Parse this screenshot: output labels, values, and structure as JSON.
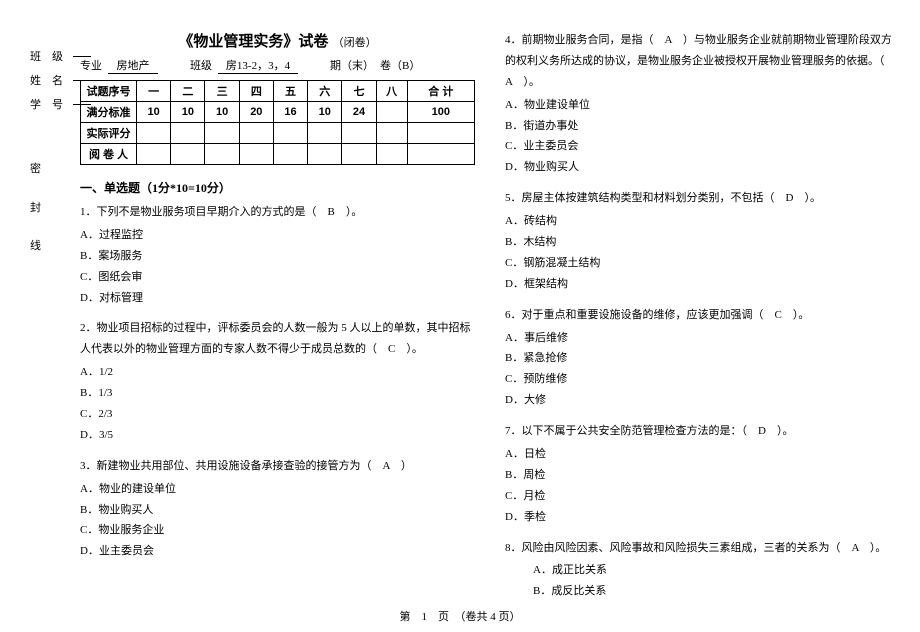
{
  "side": {
    "class_label": "班　级",
    "name_label": "姓　名",
    "id_label": "学　号"
  },
  "binding": {
    "a": "密",
    "b": "封",
    "c": "线"
  },
  "header": {
    "title": "《物业管理实务》试卷",
    "closed": "（闭卷）",
    "major_label": "专业",
    "major_value": "房地产",
    "class_label": "班级",
    "class_value": "房13-2，3，4",
    "term_label": "期（末）",
    "paper_label": "卷（B）"
  },
  "table": {
    "row0": [
      "试题序号",
      "一",
      "二",
      "三",
      "四",
      "五",
      "六",
      "七",
      "八",
      "合 计"
    ],
    "row1": [
      "满分标准",
      "10",
      "10",
      "10",
      "20",
      "16",
      "10",
      "24",
      "",
      "100"
    ],
    "row2_label": "实际评分",
    "row3_label": "阅 卷 人"
  },
  "section1_title": "一、单选题（1分*10=10分）",
  "q1": {
    "stem": "1．下列不是物业服务项目早期介入的方式的是（　B　）。",
    "a": "A．过程监控",
    "b": "B．案场服务",
    "c": "C．图纸会审",
    "d": "D．对标管理"
  },
  "q2": {
    "stem": "2．物业项目招标的过程中，评标委员会的人数一般为 5 人以上的单数，其中招标人代表以外的物业管理方面的专家人数不得少于成员总数的（　C　）。",
    "a": "A．1/2",
    "b": "B．1/3",
    "c": "C．2/3",
    "d": "D．3/5"
  },
  "q3": {
    "stem": "3．新建物业共用部位、共用设施设备承接查验的接管方为（　A　）",
    "a": "A．物业的建设单位",
    "b": "B．物业购买人",
    "c": "C．物业服务企业",
    "d": "D．业主委员会"
  },
  "q4": {
    "stem": "4．前期物业服务合同，是指（　A　）与物业服务企业就前期物业管理阶段双方的权利义务所达成的协议，是物业服务企业被授权开展物业管理服务的依据。（　A　）。",
    "a": "A．物业建设单位",
    "b": "B．街道办事处",
    "c": "C．业主委员会",
    "d": "D．物业购买人"
  },
  "q5": {
    "stem": "5．房屋主体按建筑结构类型和材料划分类别，不包括（　D　）。",
    "a": "A．砖结构",
    "b": "B．木结构",
    "c": "C．钢筋混凝土结构",
    "d": "D．框架结构"
  },
  "q6": {
    "stem": "6．对于重点和重要设施设备的维修，应该更加强调（　C　）。",
    "a": "A．事后维修",
    "b": "B．紧急抢修",
    "c": "C．预防维修",
    "d": "D．大修"
  },
  "q7": {
    "stem": "7．以下不属于公共安全防范管理检查方法的是：（　D　）。",
    "a": "A．日检",
    "b": "B．周检",
    "c": "C．月检",
    "d": "D．季检"
  },
  "q8": {
    "stem": "8．风险由风险因素、风险事故和风险损失三素组成，三者的关系为（　A　）。",
    "a": "A．成正比关系",
    "b": "B．成反比关系"
  },
  "footer": "第　1　页　（卷共 4 页）"
}
